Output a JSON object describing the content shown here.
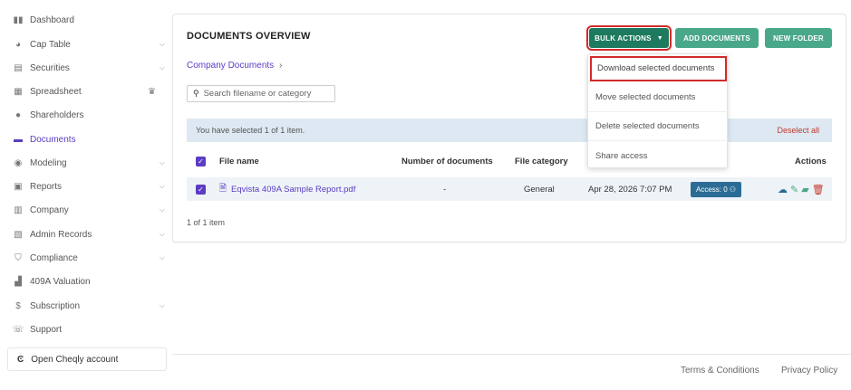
{
  "sidebar": {
    "items": [
      {
        "label": "Dashboard",
        "icon": "bar-chart-icon",
        "chevron": false
      },
      {
        "label": "Cap Table",
        "icon": "pie-chart-icon",
        "chevron": true
      },
      {
        "label": "Securities",
        "icon": "clipboard-icon",
        "chevron": true
      },
      {
        "label": "Spreadsheet",
        "icon": "table-icon",
        "chevron": false
      },
      {
        "label": "Shareholders",
        "icon": "user-icon",
        "chevron": false
      },
      {
        "label": "Documents",
        "icon": "folder-icon",
        "chevron": false
      },
      {
        "label": "Modeling",
        "icon": "bulb-icon",
        "chevron": true
      },
      {
        "label": "Reports",
        "icon": "report-icon",
        "chevron": true
      },
      {
        "label": "Company",
        "icon": "building-icon",
        "chevron": true
      },
      {
        "label": "Admin Records",
        "icon": "book-icon",
        "chevron": true
      },
      {
        "label": "Compliance",
        "icon": "shield-icon",
        "chevron": true
      },
      {
        "label": "409A Valuation",
        "icon": "trend-icon",
        "chevron": false
      },
      {
        "label": "Subscription",
        "icon": "dollar-icon",
        "chevron": true
      },
      {
        "label": "Support",
        "icon": "support-icon",
        "chevron": false
      }
    ],
    "active_label": "Documents",
    "cheqly_label": "Open Cheqly account"
  },
  "main": {
    "title": "DOCUMENTS OVERVIEW",
    "buttons": {
      "bulk": "BULK ACTIONS",
      "add": "ADD DOCUMENTS",
      "folder": "NEW FOLDER"
    },
    "breadcrumb": "Company Documents",
    "search_placeholder": "Search filename or category",
    "selection_text": "You have selected 1 of 1 item.",
    "deselect_label": "Deselect all",
    "columns": {
      "file_name": "File name",
      "num_docs": "Number of documents",
      "category": "File category",
      "actions": "Actions"
    },
    "rows": [
      {
        "file_name": "Eqvista 409A Sample Report.pdf",
        "num_docs": "-",
        "category": "General",
        "date": "Apr 28, 2026 7:07 PM",
        "access": "Access: 0"
      }
    ],
    "count_text": "1 of 1 item"
  },
  "dropdown": {
    "items": [
      "Download selected documents",
      "Move selected documents",
      "Delete selected documents",
      "Share access"
    ]
  },
  "footer": {
    "terms": "Terms & Conditions",
    "privacy": "Privacy Policy"
  },
  "colors": {
    "accent": "#5b3cc4",
    "primary_button": "#1d7a5f",
    "secondary_button": "#4aa88a",
    "highlight_border": "#d12a2a",
    "access_badge": "#2a6c95"
  }
}
